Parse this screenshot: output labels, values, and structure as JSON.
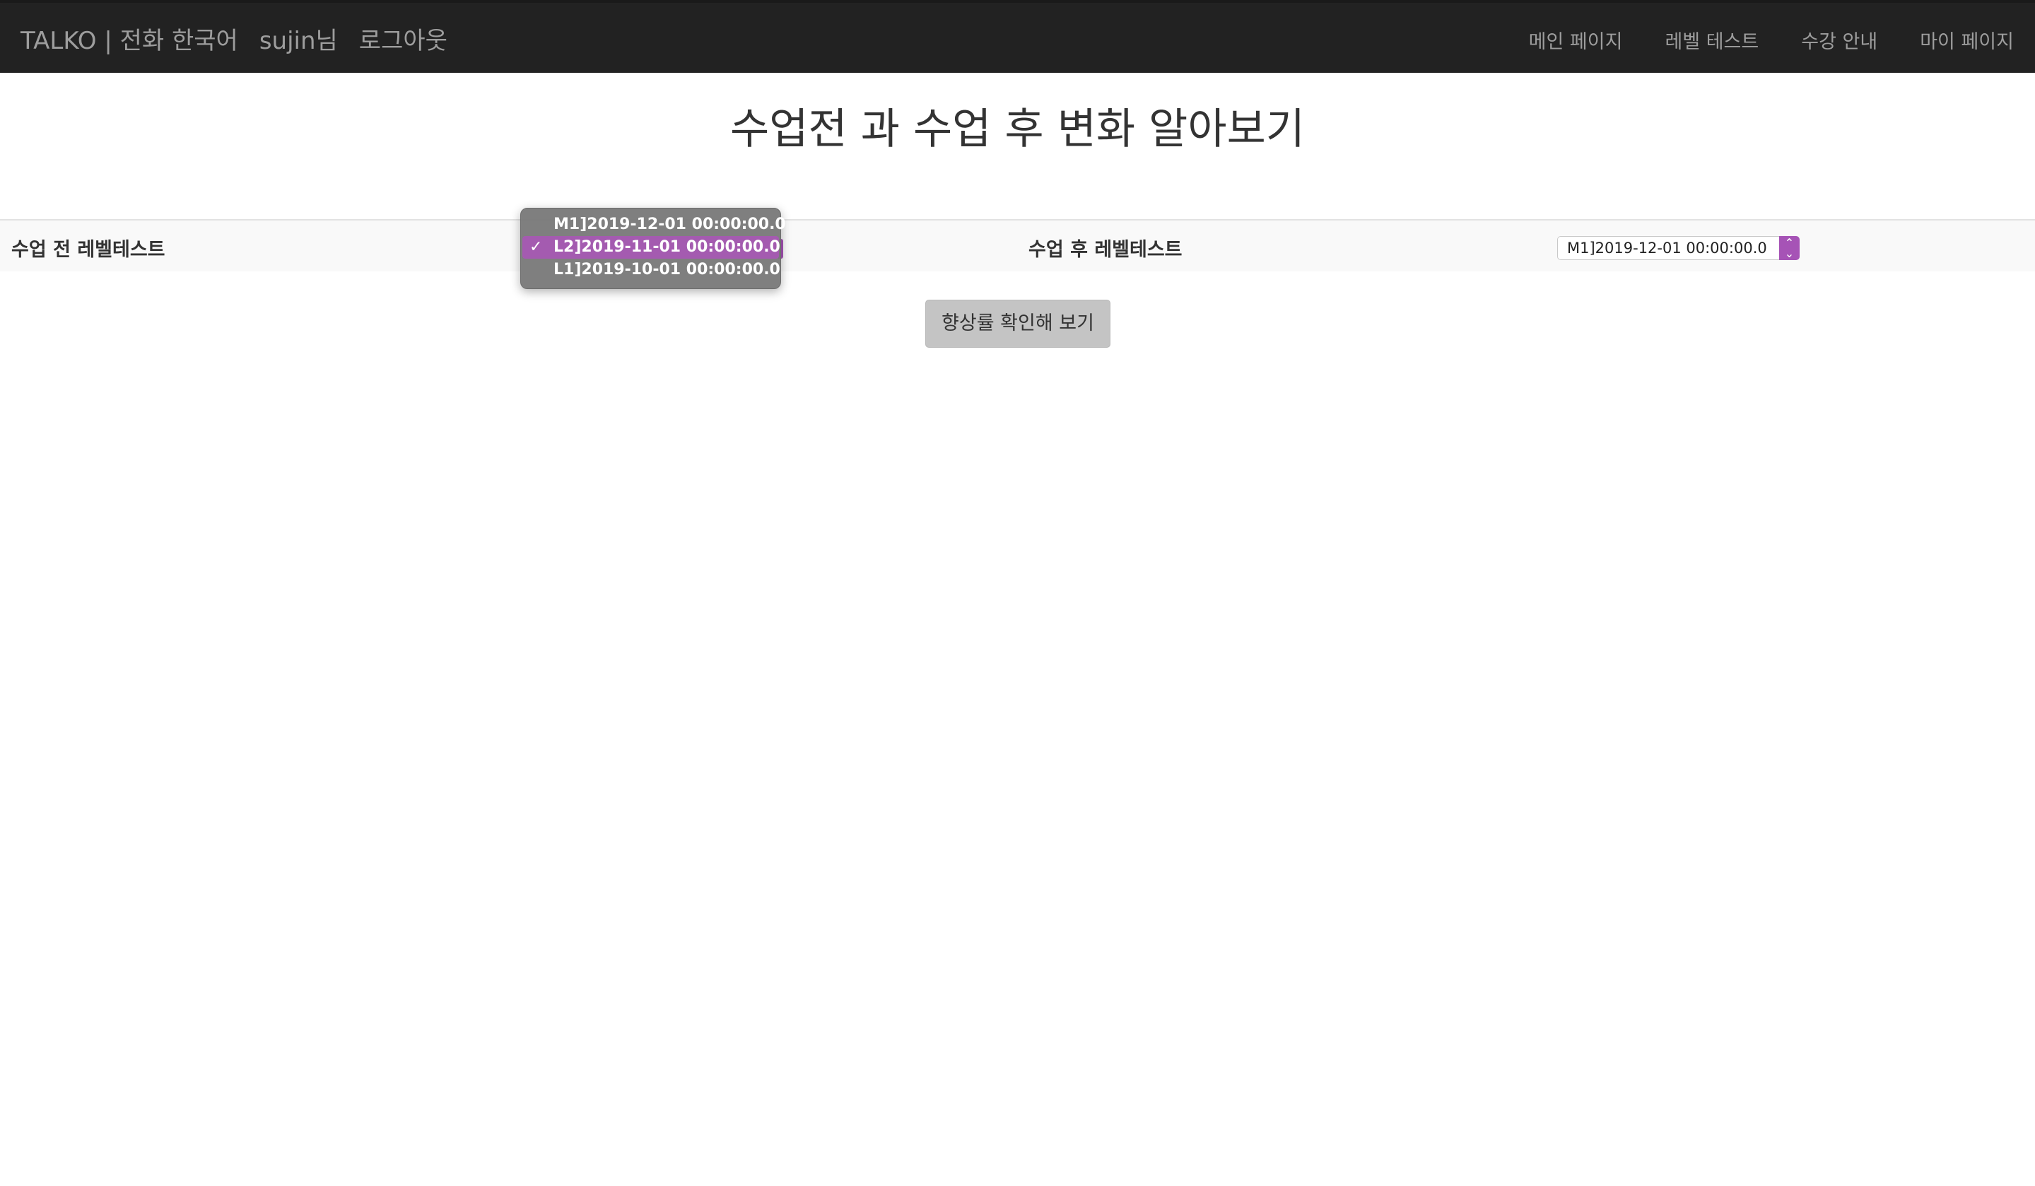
{
  "navbar": {
    "brand": "TALKO | 전화 한국어",
    "user": "sujin님",
    "logout": "로그아웃",
    "links": [
      "메인 페이지",
      "레벨 테스트",
      "수강 안내",
      "마이 페이지"
    ]
  },
  "page": {
    "title": "수업전 과 수업 후 변화 알아보기"
  },
  "compare": {
    "before_label": "수업 전 레벨테스트",
    "after_label": "수업 후 레벨테스트",
    "before_options": [
      "M1]2019-12-01 00:00:00.0",
      "L2]2019-11-01 00:00:00.0",
      "L1]2019-10-01 00:00:00.0"
    ],
    "before_selected": "L2]2019-11-01 00:00:00.0",
    "after_selected": "M1]2019-12-01 00:00:00.0"
  },
  "actions": {
    "check_button": "향상률 확인해 보기"
  },
  "icons": {
    "check": "checkmark-icon",
    "stepper": "chevron-updown-icon"
  },
  "colors": {
    "navbar_bg": "#222222",
    "select_accent": "#a653b6",
    "button_bg": "#c4c4c4"
  }
}
